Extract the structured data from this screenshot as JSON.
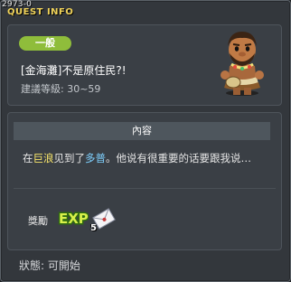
{
  "window": {
    "quest_id": "2973-0",
    "title": "QUEST INFO"
  },
  "quest": {
    "category": "一般",
    "name": "[金海灘]不是原住民?!",
    "level_label": "建議等級:",
    "level_range": "30~59"
  },
  "content": {
    "header": "內容",
    "parts": [
      "在",
      "巨浪",
      "见到了",
      "多普",
      "。他说有很重要的话要跟我说…"
    ]
  },
  "reward": {
    "label": "獎勵",
    "exp_label": "EXP",
    "item_count": "5",
    "item_icon": "envelope-icon"
  },
  "status": {
    "text": "狀態: 可開始"
  },
  "colors": {
    "accent_title": "#f0d35a",
    "category_badge": "#8fbd3b",
    "location_highlight": "#f7e46a",
    "npc_highlight": "#7fd1ff"
  }
}
